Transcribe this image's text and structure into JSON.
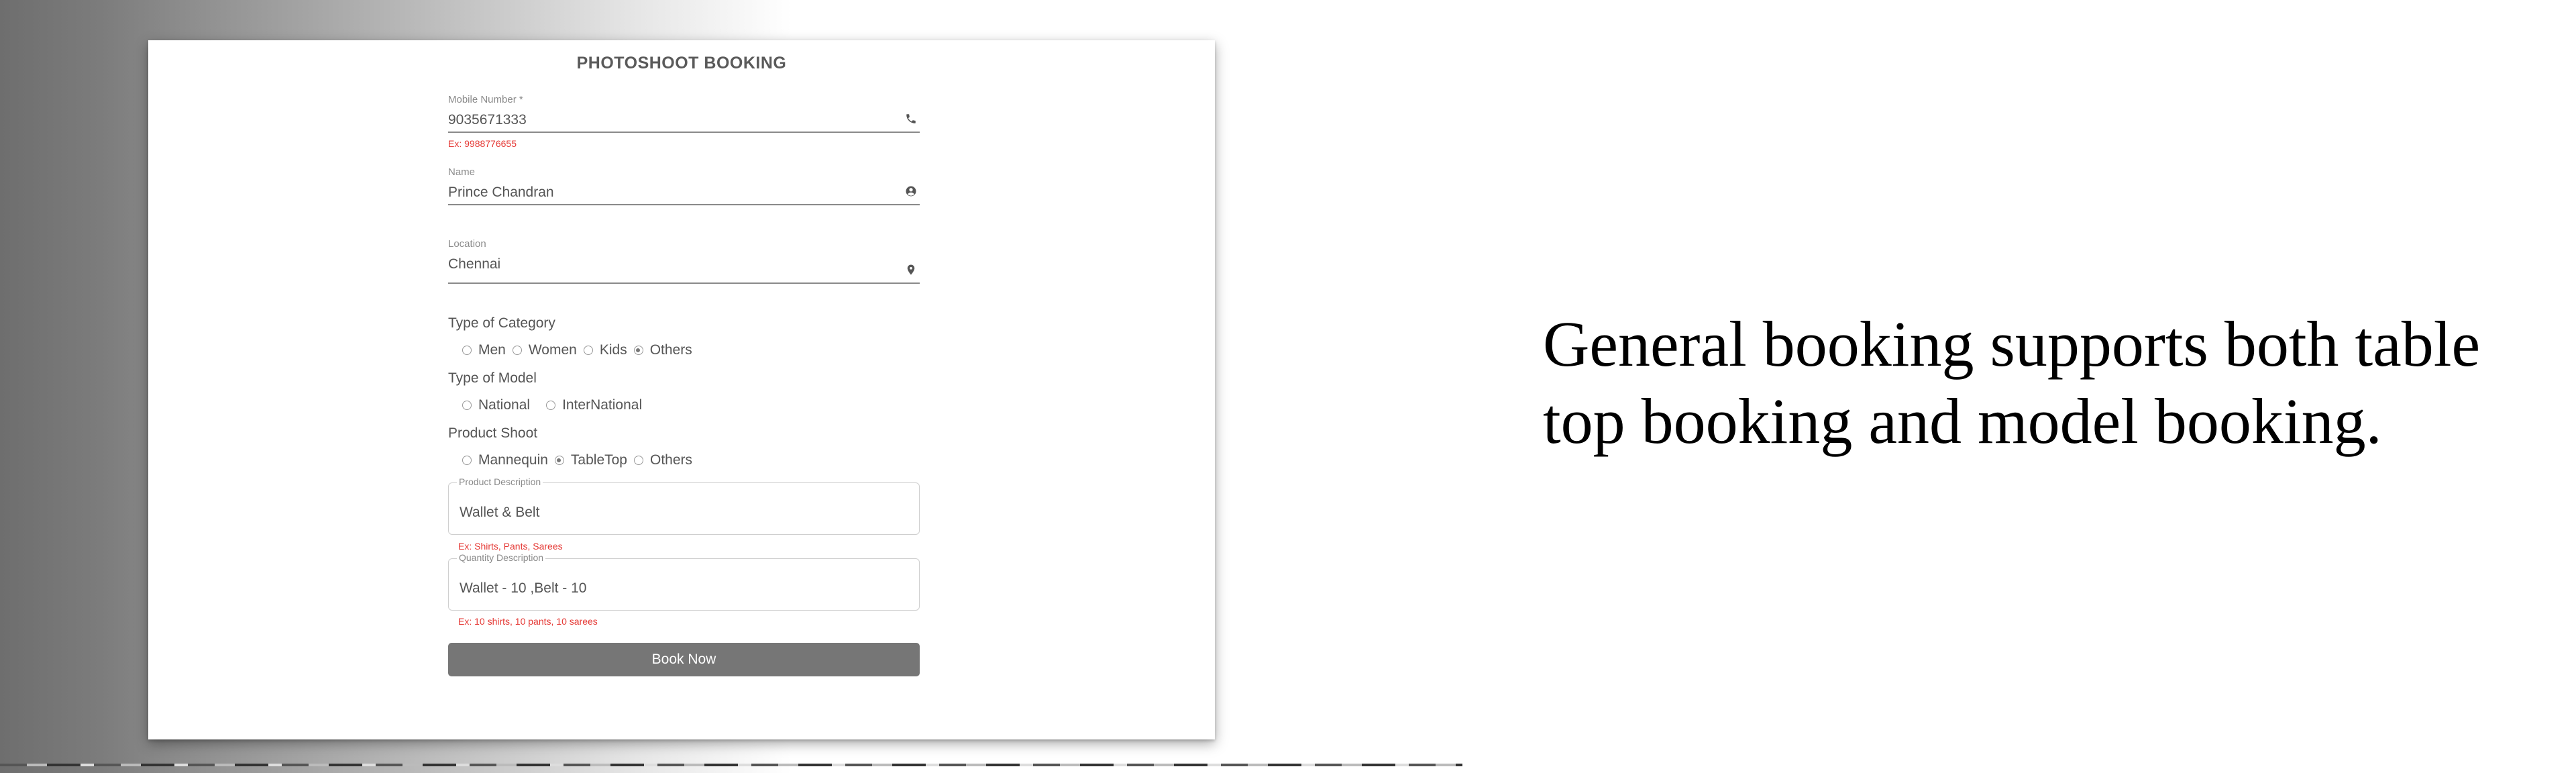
{
  "form": {
    "title": "PHOTOSHOOT BOOKING",
    "mobile": {
      "label": "Mobile Number *",
      "value": "9035671333",
      "hint": "Ex: 9988776655",
      "icon": "phone-icon"
    },
    "name": {
      "label": "Name",
      "value": "Prince Chandran",
      "icon": "account-circle-icon"
    },
    "location": {
      "label": "Location",
      "value": "Chennai",
      "icon": "location-pin-icon"
    },
    "category": {
      "label": "Type of Category",
      "options": [
        "Men",
        "Women",
        "Kids",
        "Others"
      ],
      "selected": "Others"
    },
    "model": {
      "label": "Type of Model",
      "options": [
        "National",
        "InterNational"
      ],
      "selected": ""
    },
    "product_shoot": {
      "label": "Product Shoot",
      "options": [
        "Mannequin",
        "TableTop",
        "Others"
      ],
      "selected": "TableTop"
    },
    "product_description": {
      "label": "Product Description",
      "value": "Wallet & Belt",
      "hint": "Ex: Shirts, Pants, Sarees"
    },
    "quantity_description": {
      "label": "Quantity Description",
      "value": "Wallet - 10 ,Belt - 10",
      "hint": "Ex: 10 shirts, 10 pants, 10 sarees"
    },
    "submit_label": "Book Now"
  },
  "caption": "General booking supports both table top booking and model booking.",
  "colors": {
    "hint": "#e53935",
    "button": "#767676",
    "text": "#555555"
  }
}
